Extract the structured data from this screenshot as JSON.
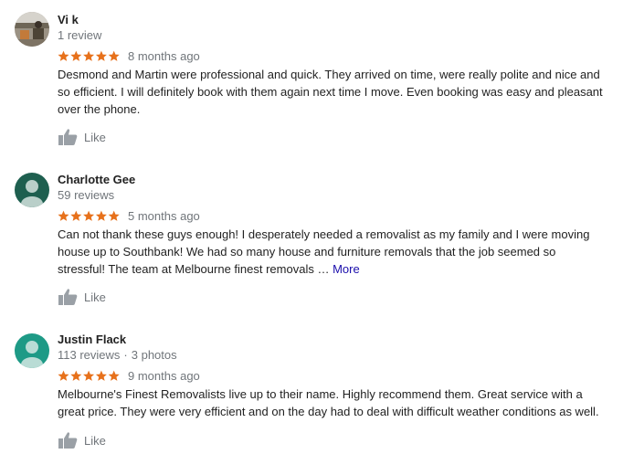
{
  "reviews": [
    {
      "name": "Vi k",
      "meta": "1 review",
      "photos": "",
      "stars": 5,
      "time": "8 months ago",
      "text": "Desmond and Martin were professional and quick. They arrived on time, were really polite and nice and so efficient. I will definitely book with them again next time I move. Even booking was easy and pleasant over the phone.",
      "more": "",
      "like": "Like",
      "avatar_color": "#8a7a63"
    },
    {
      "name": "Charlotte Gee",
      "meta": "59 reviews",
      "photos": "",
      "stars": 5,
      "time": "5 months ago",
      "text": "Can not thank these guys enough! I desperately needed a removalist as my family and I were moving house up to Southbank! We had so many house and furniture removals that the job seemed so stressful! The team at Melbourne finest removals …",
      "more": "More",
      "like": "Like",
      "avatar_color": "#1e5f4f"
    },
    {
      "name": "Justin Flack",
      "meta": "113 reviews",
      "photos": "3 photos",
      "stars": 5,
      "time": "9 months ago",
      "text": "Melbourne's Finest Removalists live up to their name. Highly recommend them. Great service with a great price. They were very efficient and on the day had to deal with difficult weather conditions as well.",
      "more": "",
      "like": "Like",
      "avatar_color": "#1e9a86"
    }
  ],
  "colors": {
    "star": "#e7711b",
    "like_icon": "#9aa0a6",
    "link": "#1a0dab"
  },
  "icons": {
    "rating": "star-icon",
    "like": "thumbs-up-icon",
    "avatar_default": "person-icon"
  }
}
